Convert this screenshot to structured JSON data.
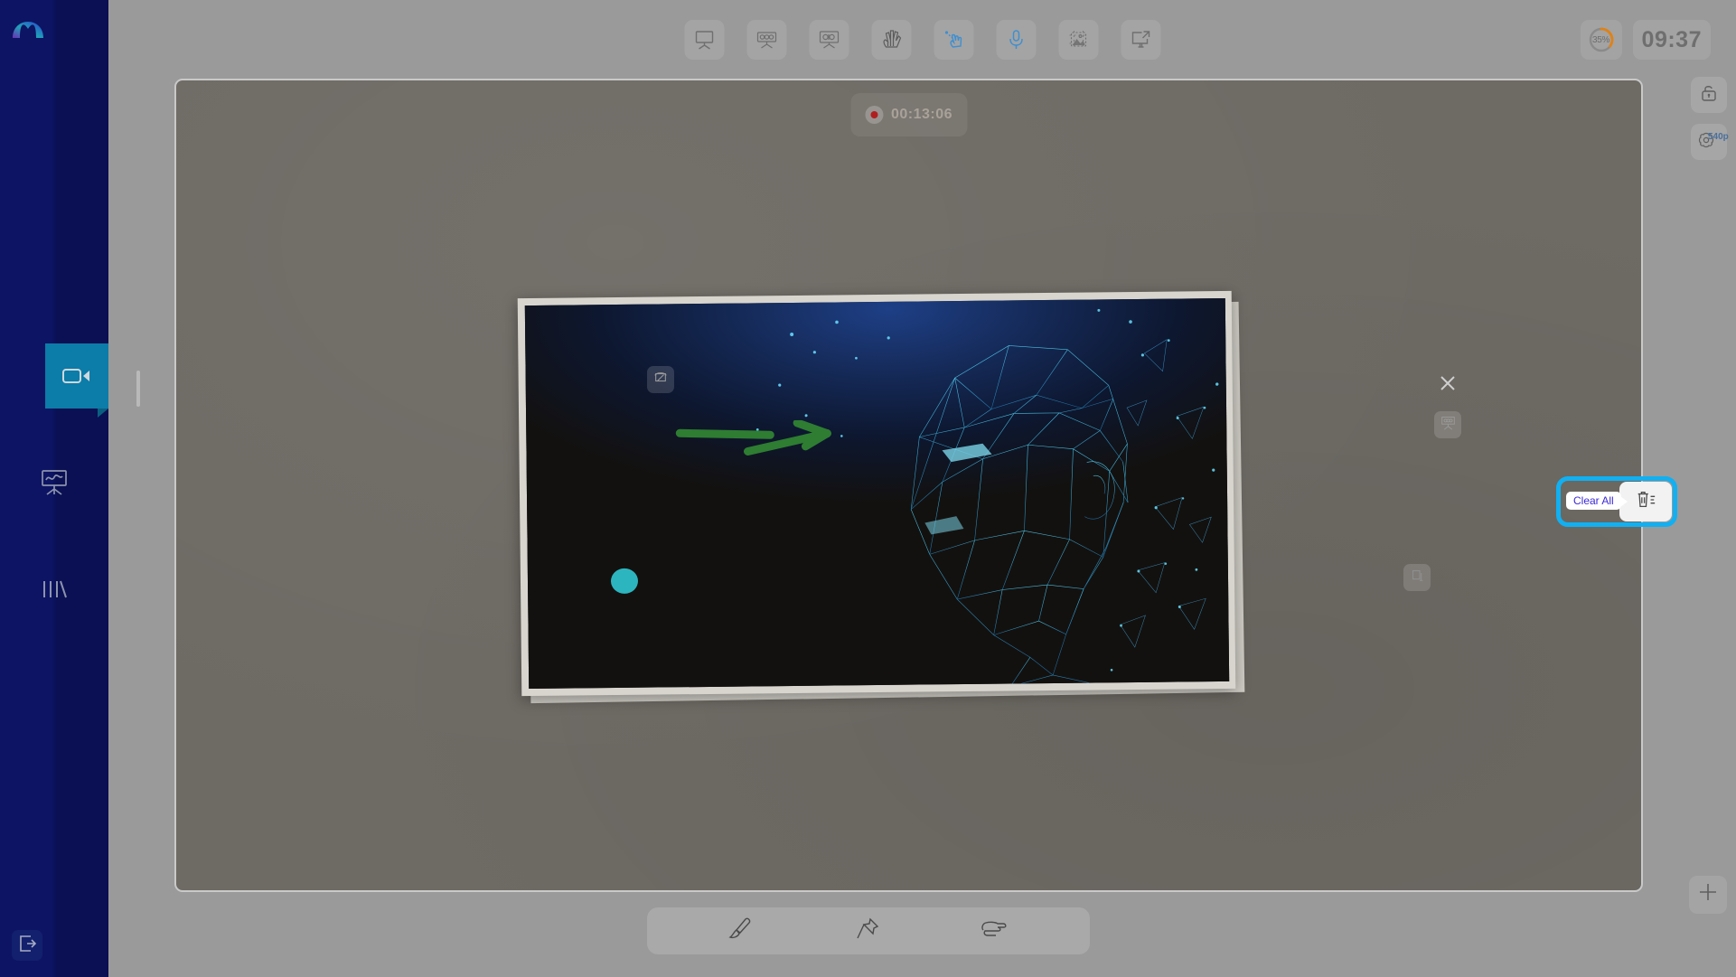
{
  "app": {
    "logo_name": "arch-logo"
  },
  "sidebar": {
    "items": [
      {
        "icon": "video-camera-icon",
        "name": "sidebar-item-recording",
        "active": true
      },
      {
        "icon": "whiteboard-chart-icon",
        "name": "sidebar-item-whiteboard",
        "active": false
      },
      {
        "icon": "bars-slash-icon",
        "name": "sidebar-item-library",
        "active": false
      }
    ],
    "exit_icon": "exit-door-icon"
  },
  "toolbar": {
    "items": [
      {
        "label": "Whiteboard",
        "icon": "easel-board-icon",
        "active": false
      },
      {
        "label": "Board Layout",
        "icon": "easel-layout-icon",
        "active": false
      },
      {
        "label": "Board Shapes",
        "icon": "easel-shapes-icon",
        "active": false
      },
      {
        "label": "Hand Gesture",
        "icon": "hand-sketch-icon",
        "active": false
      },
      {
        "label": "Pointer",
        "icon": "pointer-click-icon",
        "active": true
      },
      {
        "label": "Microphone",
        "icon": "microphone-icon",
        "active": true
      },
      {
        "label": "Image Frame",
        "icon": "image-crop-icon",
        "active": false
      },
      {
        "label": "Cast Screen",
        "icon": "screen-share-icon",
        "active": false
      }
    ]
  },
  "status": {
    "battery_percent": "35%",
    "battery_value": 35,
    "battery_color": "#e08214",
    "clock": "09:37"
  },
  "recording": {
    "elapsed": "00:13:06",
    "dot_color": "#b01f1f"
  },
  "video_card": {
    "controls": [
      {
        "label": "Rotate",
        "icon": "rotate-image-icon",
        "name": "video-rotate-button"
      },
      {
        "label": "Close",
        "icon": "close-icon",
        "name": "video-close-button"
      },
      {
        "label": "Send to Board",
        "icon": "easel-layout-icon",
        "name": "video-send-board-button"
      },
      {
        "label": "Copy",
        "icon": "copy-icon",
        "name": "video-copy-button"
      }
    ],
    "annotations": [
      {
        "type": "arrow",
        "color": "#2e7d32",
        "name": "green-arrow-annotation"
      },
      {
        "type": "dot",
        "color": "#2cb5bf",
        "name": "cyan-dot-annotation"
      }
    ],
    "content_description": "low-poly wireframe human head"
  },
  "right_controls": {
    "items": [
      {
        "label": "Lock",
        "icon": "lock-icon",
        "name": "lock-button"
      },
      {
        "label": "540p",
        "icon": "settings-gear-icon",
        "name": "resolution-button",
        "value": "540p"
      }
    ],
    "add_label": "Add",
    "add_icon": "plus-crosshair-icon"
  },
  "clear_all": {
    "tooltip": "Clear All",
    "icon": "trash-clear-icon",
    "highlight_color": "#11b0f2",
    "tooltip_text_color": "#3b29d6"
  },
  "bottom_toolbar": {
    "items": [
      {
        "label": "Brush",
        "icon": "paint-brush-icon",
        "name": "brush-tool-button"
      },
      {
        "label": "Pin",
        "icon": "push-pin-icon",
        "name": "pin-tool-button"
      },
      {
        "label": "Point",
        "icon": "pointing-hand-icon",
        "name": "point-tool-button"
      }
    ]
  }
}
